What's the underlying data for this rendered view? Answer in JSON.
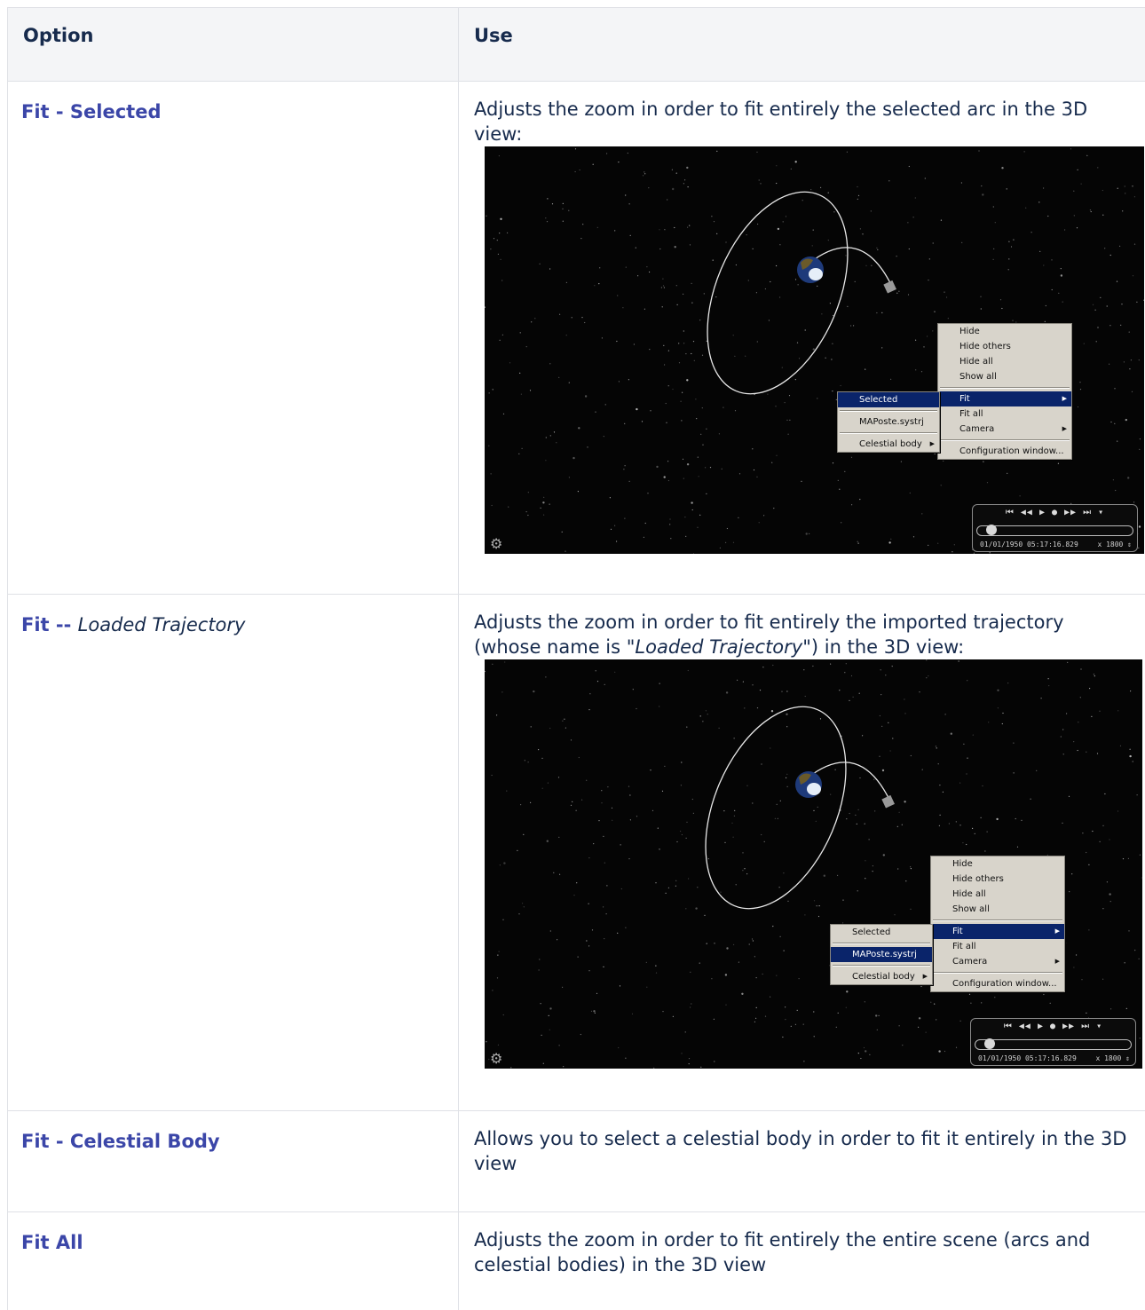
{
  "table": {
    "headers": {
      "option": "Option",
      "use": "Use"
    },
    "rows": [
      {
        "option": "Fit - Selected",
        "use": "Adjusts the zoom in order to fit entirely the selected arc in the 3D view:"
      },
      {
        "option_prefix": "Fit --",
        "option_italic": "Loaded Trajectory",
        "use_pre": "Adjusts the zoom in order to fit entirely the imported trajectory (whose name is \"",
        "use_italic": "Loaded Trajectory",
        "use_post": "\") in the 3D view:"
      },
      {
        "option": "Fit - Celestial Body",
        "use": "Allows you to select a celestial body in order to fit it entirely in the 3D view"
      },
      {
        "option": "Fit All",
        "use": "Adjusts the zoom in order to fit entirely the entire scene (arcs and celestial bodies) in the 3D view"
      }
    ]
  },
  "screenshot1": {
    "menu_main": [
      "Hide",
      "Hide others",
      "Hide all",
      "Show all",
      "Fit",
      "Fit all",
      "Camera",
      "Configuration window..."
    ],
    "menu_fit": [
      "Selected",
      "MAPoste.systrj",
      "Celestial body"
    ],
    "highlighted_main": "Fit",
    "highlighted_sub": "Selected",
    "player": {
      "controls": "⏮ ◀◀ ▶ ● ▶▶ ⏭ ▾",
      "time": "01/01/1950 05:17:16.829",
      "speed": "x 1800 ⇕"
    }
  },
  "screenshot2": {
    "menu_main": [
      "Hide",
      "Hide others",
      "Hide all",
      "Show all",
      "Fit",
      "Fit all",
      "Camera",
      "Configuration window..."
    ],
    "menu_fit": [
      "Selected",
      "MAPoste.systrj",
      "Celestial body"
    ],
    "highlighted_main": "Fit",
    "highlighted_sub": "MAPoste.systrj",
    "player": {
      "controls": "⏮ ◀◀ ▶ ● ▶▶ ⏭ ▾",
      "time": "01/01/1950 05:17:16.829",
      "speed": "x 1800 ⇕"
    }
  },
  "colors": {
    "link": "#3b46a8",
    "text": "#172b4d",
    "header_bg": "#f4f5f7",
    "border": "#dfe1e6",
    "menu_highlight": "#0a246a"
  }
}
